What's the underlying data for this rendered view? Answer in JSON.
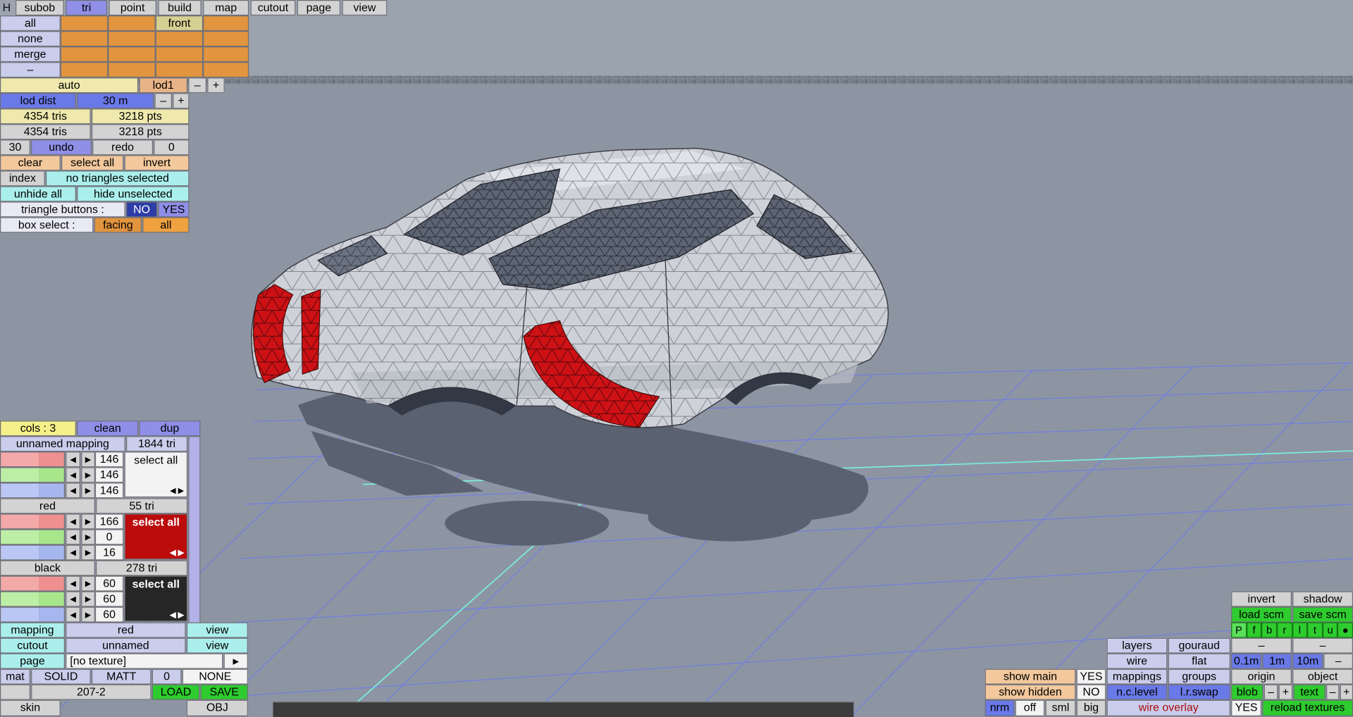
{
  "ui": {
    "minus": "–",
    "plus": "+",
    "arrow_left": "◀",
    "arrow_right": "▶"
  },
  "colors": {
    "accent_orange": "#e2953e",
    "accent_purple": "#8f8fe8",
    "accent_green": "#2ecc2e",
    "accent_blue": "#6a79e8",
    "accent_cyan": "#abefec",
    "grid_blue": "#6b79f0",
    "axis_cyan": "#79f2e4",
    "selected_red": "#ce1115"
  },
  "menubar": {
    "h": "H",
    "items": [
      "subob",
      "tri",
      "point",
      "build",
      "map",
      "cutout",
      "page",
      "view"
    ],
    "active": "tri"
  },
  "select_grid": {
    "rows": [
      "all",
      "none",
      "merge",
      "–"
    ],
    "front": "front"
  },
  "lod_bar": {
    "auto": "auto",
    "lod": "lod1"
  },
  "stats": {
    "lod_dist_label": "lod dist",
    "lod_dist_value": "30 m",
    "tris_top": "4354 tris",
    "pts_top": "3218 pts",
    "tris_bottom": "4354 tris",
    "pts_bottom": "3218 pts",
    "undo_steps": "30",
    "undo": "undo",
    "redo": "redo",
    "redo_steps": "0",
    "clear": "clear",
    "select_all": "select all",
    "invert": "invert",
    "index": "index",
    "selection_status": "no triangles selected",
    "unhide_all": "unhide all",
    "hide_unselected": "hide unselected",
    "triangle_buttons_label": "triangle buttons :",
    "no": "NO",
    "yes": "YES",
    "box_select_label": "box select :",
    "facing": "facing",
    "all": "all"
  },
  "colors_panel": {
    "cols": "cols : 3",
    "clean": "clean",
    "dup": "dup",
    "groups": [
      {
        "name": "unnamed mapping",
        "tris": "1844 tri",
        "select_all": "select all",
        "values": [
          "146",
          "146",
          "146"
        ]
      },
      {
        "name": "red",
        "tris": "55 tri",
        "select_all": "select all",
        "values": [
          "166",
          "0",
          "16"
        ]
      },
      {
        "name": "black",
        "tris": "278 tri",
        "select_all": "select all",
        "values": [
          "60",
          "60",
          "60"
        ]
      }
    ]
  },
  "mapping_rows": {
    "mapping_label": "mapping",
    "mapping_value": "red",
    "mapping_action": "view",
    "cutout_label": "cutout",
    "cutout_value": "unnamed",
    "cutout_action": "view",
    "page_label": "page",
    "page_value": "[no texture]",
    "page_action": "▶"
  },
  "material_row": {
    "mat": "mat",
    "solid": "SOLID",
    "matt": "MATT",
    "zero": "0",
    "none": "NONE"
  },
  "file_row": {
    "name": "207-2",
    "load": "LOAD",
    "save": "SAVE"
  },
  "skin_row": {
    "skin": "skin",
    "obj": "OBJ"
  },
  "right_panel": {
    "invert": "invert",
    "shadow": "shadow",
    "load_scm": "load scm",
    "save_scm": "save scm",
    "view_buttons": [
      "P",
      "f",
      "b",
      "r",
      "l",
      "t",
      "u",
      "●"
    ],
    "layers": "layers",
    "gouraud": "gouraud",
    "dash": "–",
    "wire": "wire",
    "flat": "flat",
    "grid_01": "0.1m",
    "grid_1": "1m",
    "grid_10": "10m",
    "show_main": "show main",
    "show_main_value": "YES",
    "mappings": "mappings",
    "groups": "groups",
    "origin": "origin",
    "object": "object",
    "show_hidden": "show hidden",
    "show_hidden_value": "NO",
    "nc_level": "n.c.level",
    "lr_swap": "l.r.swap",
    "blob": "blob",
    "text_btn": "text",
    "nrm": "nrm",
    "off": "off",
    "sml": "sml",
    "big": "big",
    "wire_overlay": "wire overlay",
    "wire_overlay_value": "YES",
    "reload_textures": "reload textures"
  }
}
